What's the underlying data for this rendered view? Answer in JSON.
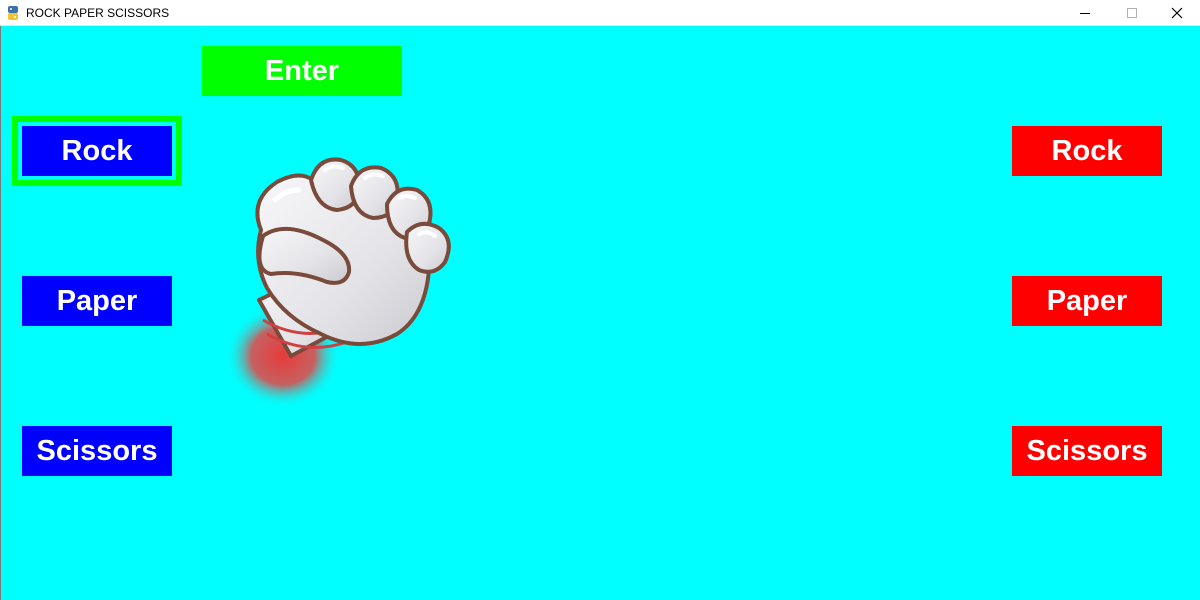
{
  "window": {
    "title": "ROCK PAPER SCISSORS",
    "controls": {
      "minimize": "—",
      "maximize": "☐",
      "close": "✕"
    }
  },
  "colors": {
    "background": "#00ffff",
    "player_button": "#0000ff",
    "computer_button": "#ff0000",
    "enter_button": "#00ff00",
    "selection_frame": "#00ff00",
    "button_text": "#ffffff"
  },
  "enter_button": {
    "label": "Enter"
  },
  "player": {
    "selected": "Rock",
    "buttons": [
      {
        "label": "Rock"
      },
      {
        "label": "Paper"
      },
      {
        "label": "Scissors"
      }
    ]
  },
  "computer": {
    "buttons": [
      {
        "label": "Rock"
      },
      {
        "label": "Paper"
      },
      {
        "label": "Scissors"
      }
    ]
  },
  "hand_image": {
    "icon": "rock-fist-icon"
  }
}
